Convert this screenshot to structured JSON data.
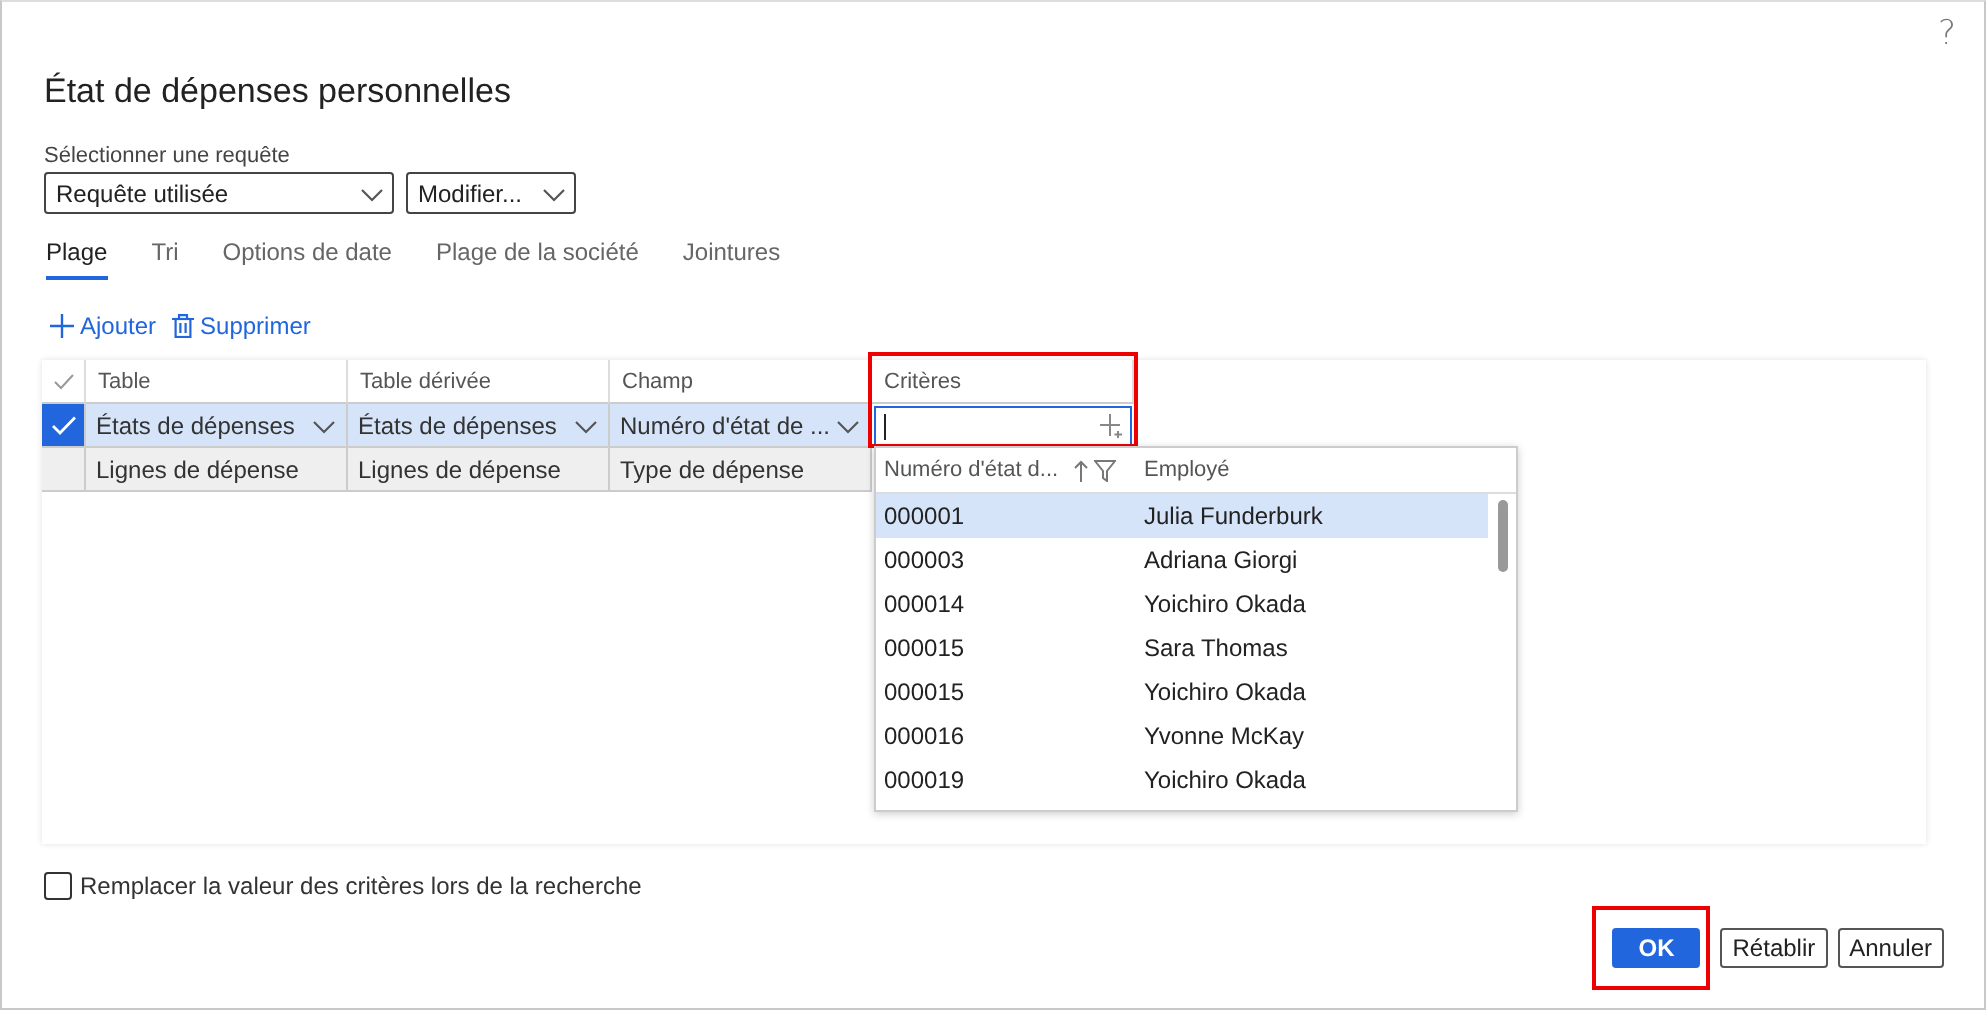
{
  "dialog": {
    "title": "État de dépenses personnelles",
    "help": "?"
  },
  "query": {
    "label": "Sélectionner une requête",
    "value": "Requête utilisée",
    "modify_button": "Modifier..."
  },
  "tabs": [
    {
      "label": "Plage",
      "selected": true
    },
    {
      "label": "Tri",
      "selected": false
    },
    {
      "label": "Options de date",
      "selected": false
    },
    {
      "label": "Plage de la société",
      "selected": false
    },
    {
      "label": "Jointures",
      "selected": false
    }
  ],
  "toolbar": [
    {
      "kind": "add",
      "label": "Ajouter"
    },
    {
      "kind": "delete",
      "label": "Supprimer"
    }
  ],
  "grid": {
    "columns": [
      {
        "label": "Table",
        "highlighted": false
      },
      {
        "label": "Table dérivée",
        "highlighted": false
      },
      {
        "label": "Champ",
        "highlighted": false
      },
      {
        "label": "Critères",
        "highlighted": true
      }
    ],
    "rows": [
      {
        "selected": true,
        "cells": [
          "États de dépenses",
          "États de dépenses",
          "Numéro d'état de ..."
        ]
      },
      {
        "selected": false,
        "cells": [
          "Lignes de dépense",
          "Lignes de dépense",
          "Type de dépense"
        ]
      }
    ]
  },
  "lookup": {
    "columns": [
      "Numéro d'état d...",
      "Employé"
    ],
    "rows": [
      {
        "selected": true,
        "cells": [
          "000001",
          "Julia Funderburk"
        ]
      },
      {
        "selected": false,
        "cells": [
          "000003",
          "Adriana Giorgi"
        ]
      },
      {
        "selected": false,
        "cells": [
          "000014",
          "Yoichiro Okada"
        ]
      },
      {
        "selected": false,
        "cells": [
          "000015",
          "Sara Thomas"
        ]
      },
      {
        "selected": false,
        "cells": [
          "000015",
          "Yoichiro Okada"
        ]
      },
      {
        "selected": false,
        "cells": [
          "000016",
          "Yvonne McKay"
        ]
      },
      {
        "selected": false,
        "cells": [
          "000019",
          "Yoichiro Okada"
        ]
      }
    ]
  },
  "replace_checkbox": {
    "label": "Remplacer la valeur des critères lors de la recherche",
    "checked": false
  },
  "buttons": [
    {
      "label": "OK",
      "kind": "primary",
      "highlighted": true
    },
    {
      "label": "Rétablir",
      "kind": "secondary",
      "highlighted": false
    },
    {
      "label": "Annuler",
      "kind": "secondary",
      "highlighted": false
    }
  ]
}
